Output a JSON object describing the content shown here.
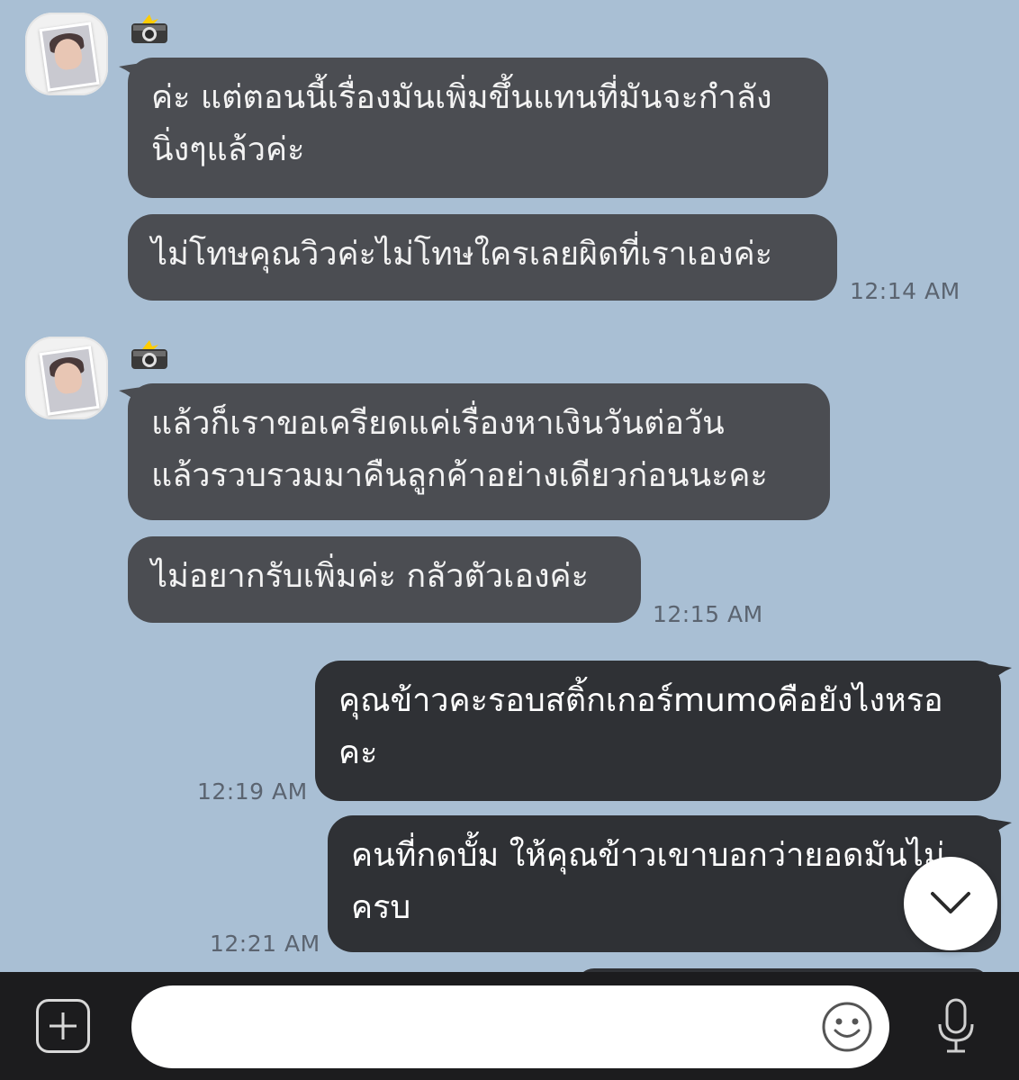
{
  "messages": [
    {
      "text": "ค่ะ แต่ตอนนี้เรื่องมันเพิ่มขึ้นแทนที่มันจะกำลัง\nนิ่งๆแล้วค่ะ"
    },
    {
      "text": "ไม่โทษคุณวิวค่ะไม่โทษใครเลยผิดที่เราเองค่ะ",
      "time": "12:14 AM"
    },
    {
      "text": "แล้วก็เราขอเครียดแค่เรื่องหาเงินวันต่อวัน\nแล้วรวบรวมมาคืนลูกค้าอย่างเดียวก่อนนะคะ"
    },
    {
      "text": "ไม่อยากรับเพิ่มค่ะ กลัวตัวเองค่ะ",
      "time": "12:15 AM"
    },
    {
      "text": "คุณข้าวคะรอบสติ้กเกอร์mumoคือยังไงหรอ\nคะ",
      "time": "12:19 AM"
    },
    {
      "text": "คนที่กดบั้ม ให้คุณข้าวเขาบอกว่ายอดมันไม่\nครบ",
      "time": "12:21 AM"
    }
  ],
  "input": {
    "placeholder": "",
    "value": ""
  },
  "icons": {
    "camera": "camera-flash-icon",
    "scroll": "chevron-down-icon",
    "add": "plus-icon",
    "emoji": "smiley-icon",
    "mic": "microphone-icon"
  },
  "colors": {
    "background": "#a9bfd4",
    "incoming_bubble": "#4b4d52",
    "outgoing_bubble": "#2f3135",
    "bottom_bar": "#1c1c1e"
  }
}
